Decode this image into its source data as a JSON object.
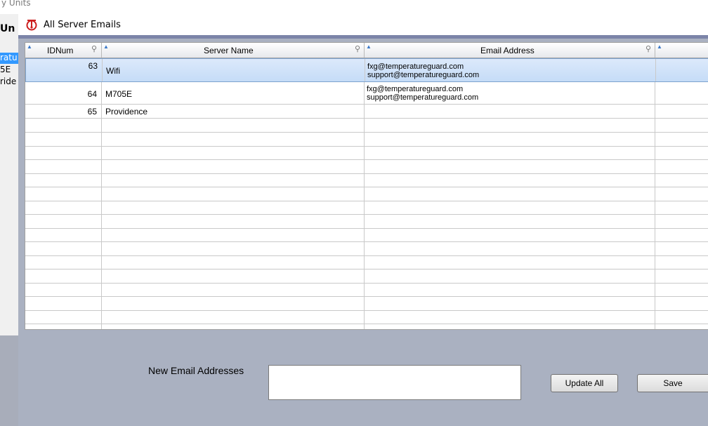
{
  "background": {
    "title": "y Units",
    "header": "Un",
    "items": [
      "ratu",
      "5E",
      "ride"
    ]
  },
  "dialog": {
    "title": "All Server Emails",
    "icon": "temperature-guard-logo-icon"
  },
  "grid": {
    "columns": [
      "IDNum",
      "Server Name",
      "Email Address",
      ""
    ],
    "rows": [
      {
        "id": "63",
        "name": "Wifi",
        "emails": "fxg@temperatureguard.com\nsupport@temperatureguard.com",
        "selected": true
      },
      {
        "id": "64",
        "name": "M705E",
        "emails": "fxg@temperatureguard.com\nsupport@temperatureguard.com",
        "selected": false
      },
      {
        "id": "65",
        "name": "Providence",
        "emails": "",
        "selected": false
      }
    ],
    "empty_row_count": 16
  },
  "form": {
    "new_email_label": "New Email Addresses",
    "new_email_value": "",
    "update_all_label": "Update All",
    "save_label": "Save"
  },
  "colors": {
    "dialog_bg": "#aab1c1",
    "selection": "#c5dcf7",
    "title_accent": "#7c84a8"
  }
}
